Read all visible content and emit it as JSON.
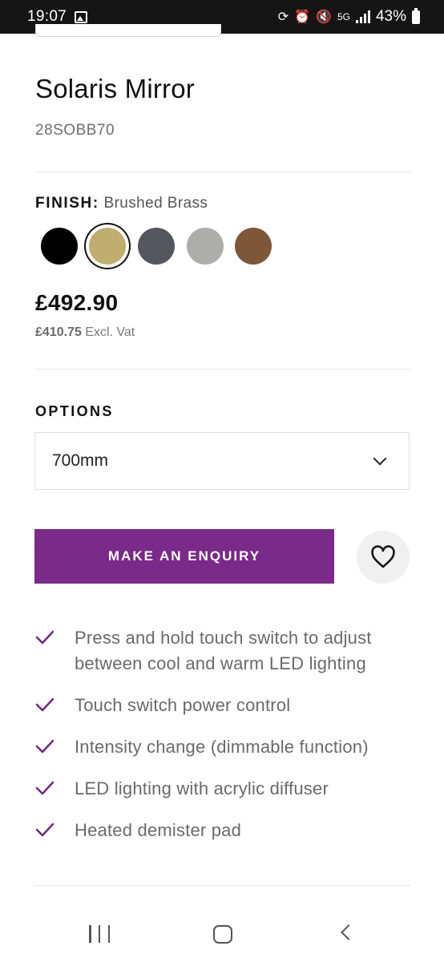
{
  "status_bar": {
    "time": "19:07",
    "network": "5G",
    "battery": "43%",
    "icons": [
      "gallery-icon",
      "sync-icon",
      "alarm-icon",
      "mute-icon",
      "signal-icon",
      "battery-icon"
    ]
  },
  "product": {
    "title": "Solaris Mirror",
    "sku": "28SOBB70"
  },
  "finish": {
    "label": "FINISH:",
    "selected": "Brushed Brass",
    "swatches": [
      {
        "name": "black",
        "color": "#000000"
      },
      {
        "name": "brushed-brass",
        "color": "#bfae6f"
      },
      {
        "name": "gunmetal",
        "color": "#53565c"
      },
      {
        "name": "silver",
        "color": "#adadab"
      },
      {
        "name": "bronze",
        "color": "#7e573a"
      }
    ]
  },
  "pricing": {
    "price": "£492.90",
    "ex_vat_amount": "£410.75",
    "ex_vat_label": "Excl. Vat"
  },
  "options": {
    "title": "OPTIONS",
    "selected": "700mm"
  },
  "actions": {
    "enquiry_label": "MAKE AN ENQUIRY"
  },
  "features": [
    "Press and hold touch switch to adjust between cool and warm LED lighting",
    "Touch switch power control",
    "Intensity change (dimmable function)",
    "LED lighting with acrylic diffuser",
    "Heated demister pad"
  ],
  "colors": {
    "accent": "#7a2a88",
    "check": "#6b2d7a"
  }
}
